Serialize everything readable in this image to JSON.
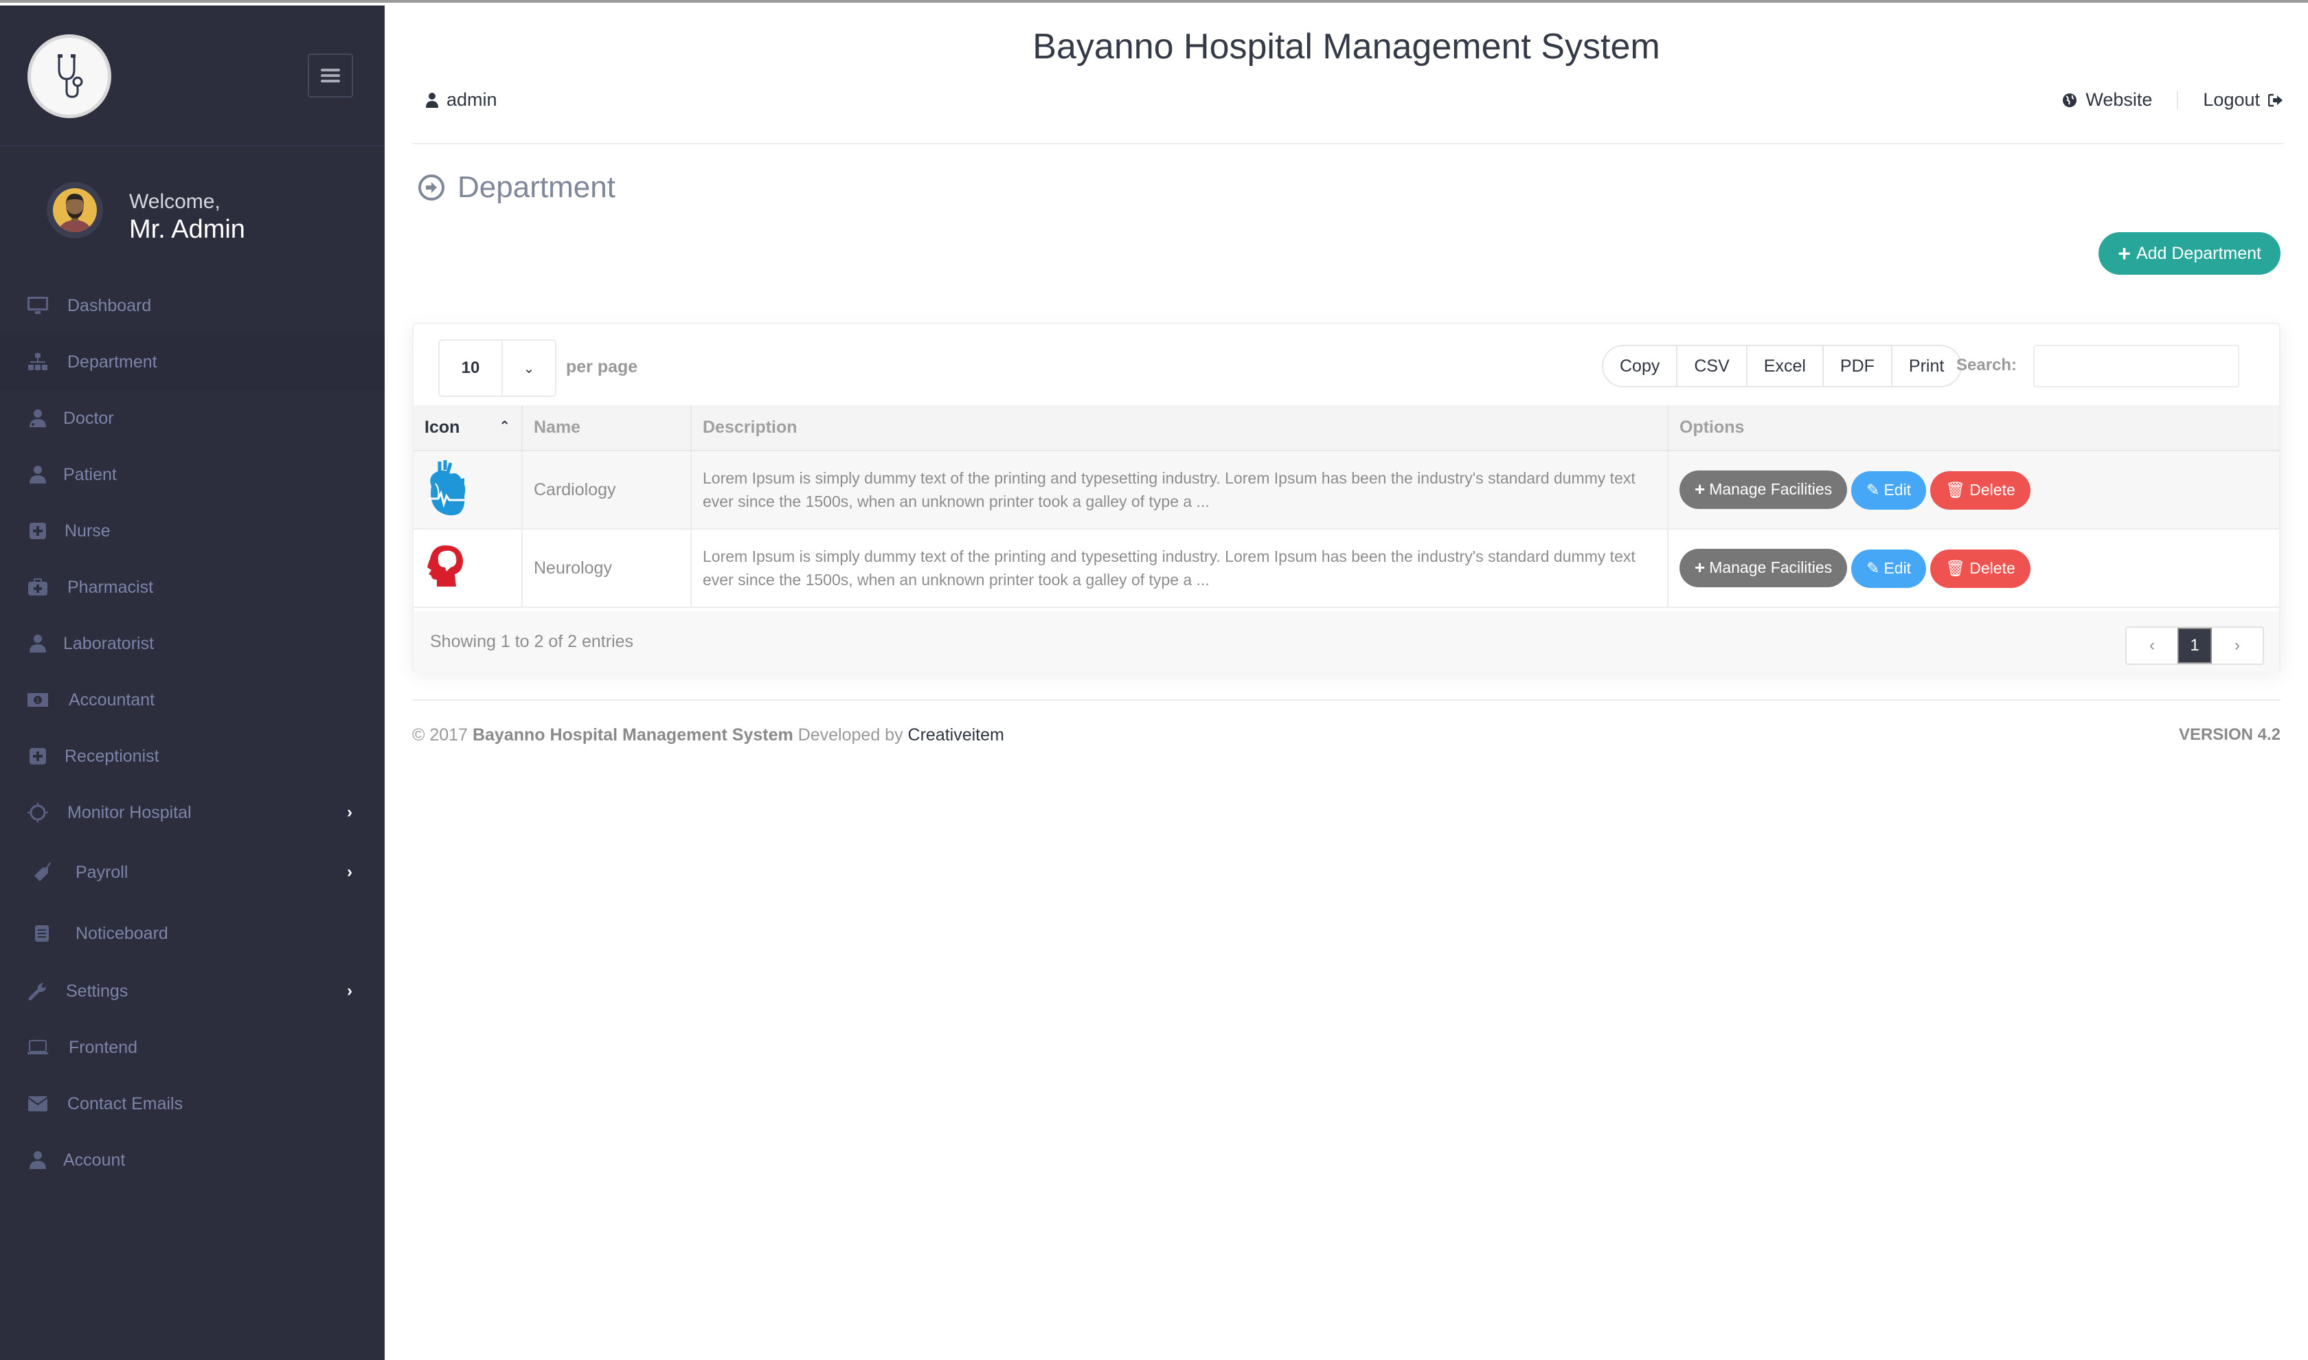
{
  "app": {
    "title": "Bayanno Hospital Management System"
  },
  "header": {
    "user_label": "admin",
    "website_label": "Website",
    "logout_label": "Logout"
  },
  "sidebar": {
    "welcome": "Welcome,",
    "user_name": "Mr. Admin",
    "items": [
      {
        "label": "Dashboard",
        "icon": "monitor-icon",
        "active": false,
        "has_submenu": false
      },
      {
        "label": "Department",
        "icon": "sitemap-icon",
        "active": true,
        "has_submenu": false
      },
      {
        "label": "Doctor",
        "icon": "user-md-icon",
        "active": false,
        "has_submenu": false
      },
      {
        "label": "Patient",
        "icon": "user-icon",
        "active": false,
        "has_submenu": false
      },
      {
        "label": "Nurse",
        "icon": "plus-square-icon",
        "active": false,
        "has_submenu": false
      },
      {
        "label": "Pharmacist",
        "icon": "medkit-icon",
        "active": false,
        "has_submenu": false
      },
      {
        "label": "Laboratorist",
        "icon": "user-icon",
        "active": false,
        "has_submenu": false
      },
      {
        "label": "Accountant",
        "icon": "money-icon",
        "active": false,
        "has_submenu": false
      },
      {
        "label": "Receptionist",
        "icon": "plus-square-icon",
        "active": false,
        "has_submenu": false
      },
      {
        "label": "Monitor Hospital",
        "icon": "sun-icon",
        "active": false,
        "has_submenu": true
      },
      {
        "label": "Payroll",
        "icon": "tag-icon",
        "active": false,
        "has_submenu": true
      },
      {
        "label": "Noticeboard",
        "icon": "document-icon",
        "active": false,
        "has_submenu": false
      },
      {
        "label": "Settings",
        "icon": "wrench-icon",
        "active": false,
        "has_submenu": true
      },
      {
        "label": "Frontend",
        "icon": "laptop-icon",
        "active": false,
        "has_submenu": false
      },
      {
        "label": "Contact Emails",
        "icon": "envelope-icon",
        "active": false,
        "has_submenu": false
      },
      {
        "label": "Account",
        "icon": "user-icon",
        "active": false,
        "has_submenu": false
      }
    ]
  },
  "page": {
    "title": "Department",
    "add_button": "Add Department"
  },
  "table_controls": {
    "page_length": "10",
    "per_page_label": "per page",
    "export_buttons": [
      "Copy",
      "CSV",
      "Excel",
      "PDF",
      "Print"
    ],
    "search_label": "Search:",
    "search_value": ""
  },
  "table": {
    "columns": [
      "Icon",
      "Name",
      "Description",
      "Options"
    ],
    "sorted_column": "Icon",
    "rows": [
      {
        "icon": "heart-icon",
        "icon_color": "#1e96d8",
        "name": "Cardiology",
        "description": "Lorem Ipsum is simply dummy text of the printing and typesetting industry. Lorem Ipsum has been the industry's standard dummy text ever since the 1500s, when an unknown printer took a galley of type a ..."
      },
      {
        "icon": "brain-head-icon",
        "icon_color": "#d81e2a",
        "name": "Neurology",
        "description": "Lorem Ipsum is simply dummy text of the printing and typesetting industry. Lorem Ipsum has been the industry's standard dummy text ever since the 1500s, when an unknown printer took a galley of type a ..."
      }
    ],
    "row_actions": {
      "manage": "Manage Facilities",
      "edit": "Edit",
      "delete": "Delete"
    },
    "info": "Showing 1 to 2 of 2 entries",
    "pagination": {
      "prev": "‹",
      "current": "1",
      "next": "›"
    }
  },
  "footer": {
    "copyright": "© 2017",
    "system_name": "Bayanno Hospital Management System",
    "developed_by": "Developed by",
    "developer": "Creativeitem",
    "version": "VERSION 4.2"
  },
  "colors": {
    "sidebar_bg": "#2c2e3e",
    "accent_teal": "#27a699",
    "manage_btn": "#777777",
    "edit_btn": "#45a7f5",
    "delete_btn": "#ef5350"
  }
}
